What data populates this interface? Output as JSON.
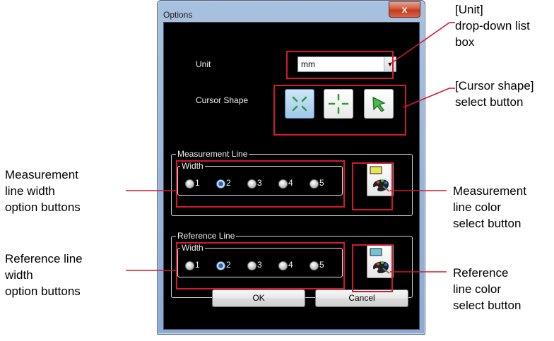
{
  "dialog": {
    "title": "Options",
    "close_glyph": "x",
    "unit_label": "Unit",
    "unit_value": "mm",
    "cursor_shape_label": "Cursor Shape",
    "cursor_buttons": [
      "cross-diagonal-icon",
      "crosshair-icon",
      "arrow-pointer-icon"
    ],
    "measurement": {
      "group_title": "Measurement Line",
      "width_title": "Width",
      "options": [
        "1",
        "2",
        "3",
        "4",
        "5"
      ],
      "selected": "2",
      "swatch_color": "#e8e452"
    },
    "reference": {
      "group_title": "Reference Line",
      "width_title": "Width",
      "options": [
        "1",
        "2",
        "3",
        "4",
        "5"
      ],
      "selected": "2",
      "swatch_color": "#6cc6d8"
    },
    "ok_label": "OK",
    "cancel_label": "Cancel"
  },
  "annotations": {
    "unit": [
      "[Unit]",
      "drop-down list",
      "box"
    ],
    "cursor": [
      "[Cursor shape]",
      "select button"
    ],
    "meas_width": [
      "Measurement",
      "line width",
      "option buttons"
    ],
    "ref_width": [
      "Reference line",
      "width",
      "option buttons"
    ],
    "meas_color": [
      "Measurement",
      "line color",
      "select button"
    ],
    "ref_color": [
      "Reference",
      "line color",
      "select button"
    ]
  },
  "colors": {
    "highlight": "#d6182c",
    "selected_cursor": "#9fc8ea"
  }
}
